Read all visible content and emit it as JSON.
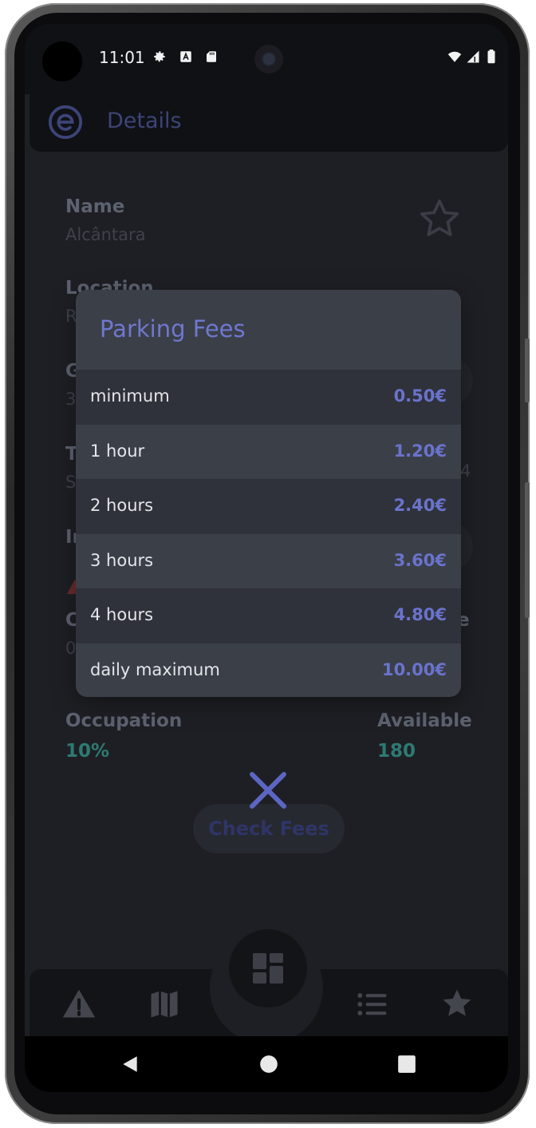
{
  "status_bar": {
    "time": "11:01",
    "icons": [
      "settings-icon",
      "font-a-icon",
      "sd-card-icon",
      "wifi-icon",
      "signal-icon",
      "battery-icon"
    ]
  },
  "app_bar": {
    "title": "Details",
    "logo_icon": "e-logo-icon"
  },
  "details": {
    "name_label": "Name",
    "name_value": "Alcântara",
    "location_label": "Location",
    "location_value_fragment": "R",
    "row3_label_fragment": "G",
    "row3_value_fragment": "3",
    "row4_label_fragment": "T",
    "row4_value_fragment": "S",
    "row4_right_fragment": "4",
    "row5_label_fragment": "In",
    "row6_label_fragment": "C",
    "row6_value_fragment": "0",
    "row6_right_fragment": "e",
    "occupation_label": "Occupation",
    "occupation_value": "10%",
    "available_label": "Available",
    "available_value": "180",
    "check_fees_label": "Check Fees"
  },
  "dialog": {
    "title": "Parking Fees",
    "fees": [
      {
        "label": "minimum",
        "price": "0.50€"
      },
      {
        "label": "1 hour",
        "price": "1.20€"
      },
      {
        "label": "2 hours",
        "price": "2.40€"
      },
      {
        "label": "3 hours",
        "price": "3.60€"
      },
      {
        "label": "4 hours",
        "price": "4.80€"
      },
      {
        "label": "daily maximum",
        "price": "10.00€"
      }
    ]
  },
  "bottom_nav": {
    "items": [
      "warning-icon",
      "map-icon",
      "dashboard-icon",
      "list-icon",
      "star-icon"
    ]
  },
  "colors": {
    "accent": "#6f78cf",
    "teal": "#2d7a73",
    "dialog_bg": "#3b3f48",
    "screen_bg": "#1e1f24"
  }
}
